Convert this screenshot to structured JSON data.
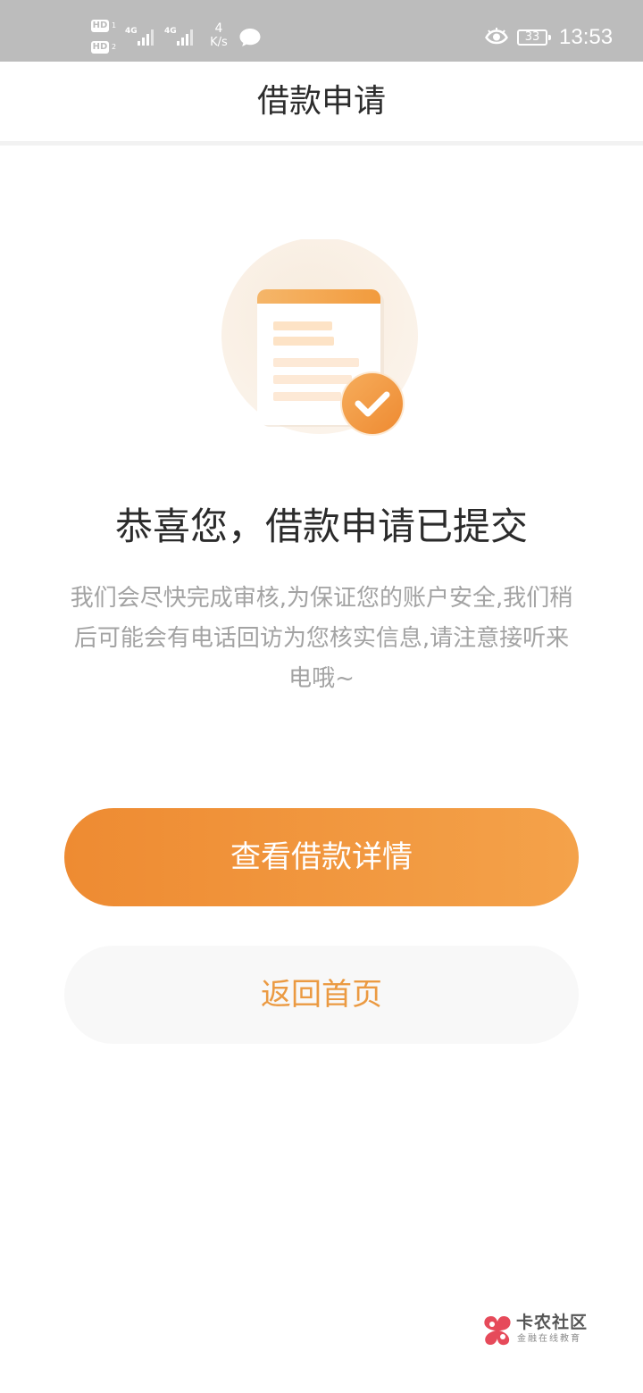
{
  "status_bar": {
    "hd_1": "HD",
    "hd_1_num": "1",
    "hd_2": "HD",
    "hd_2_num": "2",
    "network_1": "4G",
    "network_2": "4G",
    "speed_value": "4",
    "speed_unit": "K/s",
    "battery_level": "33",
    "time": "13:53",
    "icons": [
      "message-icon",
      "eye-icon",
      "battery-icon",
      "signal-icon"
    ]
  },
  "nav": {
    "title": "借款申请"
  },
  "result": {
    "icon": "document-check-icon",
    "title": "恭喜您，借款申请已提交",
    "description": "我们会尽快完成审核,为保证您的账户安全,我们稍后可能会有电话回访为您核实信息,请注意接听来电哦~"
  },
  "buttons": {
    "view_details": "查看借款详情",
    "back_home": "返回首页"
  },
  "colors": {
    "accent": "#F0903A",
    "secondary_text": "#EB9A42",
    "status_bar": "#BCBCBC"
  },
  "watermark": {
    "name": "卡农社区",
    "subtitle": "金融在线教育"
  }
}
